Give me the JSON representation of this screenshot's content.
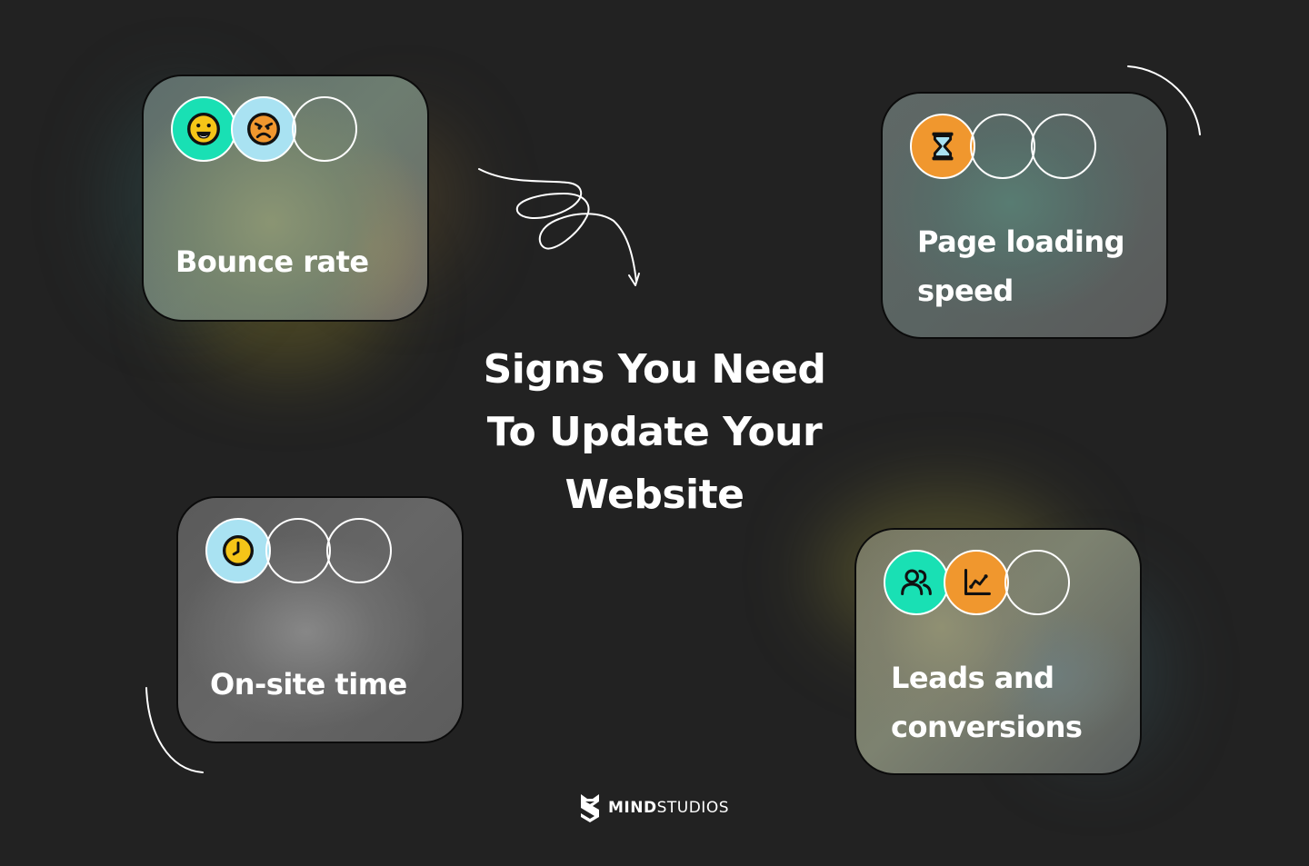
{
  "headline": {
    "line1": "Signs You Need",
    "line2": "To Update Your",
    "line3": "Website"
  },
  "cards": [
    {
      "id": "bounce-rate",
      "label": "Bounce rate",
      "icons": [
        {
          "name": "grinning-face-icon",
          "bg": "#19e0b4"
        },
        {
          "name": "angry-face-icon",
          "bg": "#a9e2f2"
        },
        {
          "name": "empty-circle",
          "bg": "transparent"
        }
      ]
    },
    {
      "id": "page-loading-speed",
      "label_line1": "Page loading",
      "label_line2": "speed",
      "icons": [
        {
          "name": "hourglass-icon",
          "bg": "#f0972e"
        },
        {
          "name": "empty-circle",
          "bg": "transparent"
        },
        {
          "name": "empty-circle",
          "bg": "transparent"
        }
      ]
    },
    {
      "id": "on-site-time",
      "label": "On-site time",
      "icons": [
        {
          "name": "clock-icon",
          "bg": "#a9e2f2"
        },
        {
          "name": "empty-circle",
          "bg": "transparent"
        },
        {
          "name": "empty-circle",
          "bg": "transparent"
        }
      ]
    },
    {
      "id": "leads-and-conversions",
      "label_line1": "Leads and",
      "label_line2": "conversions",
      "icons": [
        {
          "name": "users-icon",
          "bg": "#19e0b4"
        },
        {
          "name": "line-chart-icon",
          "bg": "#f0972e"
        },
        {
          "name": "empty-circle",
          "bg": "transparent"
        }
      ]
    }
  ],
  "logo": {
    "bold": "MIND",
    "light": "STUDIOS"
  },
  "colors": {
    "background": "#222222",
    "teal": "#19e0b4",
    "light_blue": "#a9e2f2",
    "orange": "#f0972e",
    "yellow": "#f5c518",
    "white": "#ffffff"
  }
}
